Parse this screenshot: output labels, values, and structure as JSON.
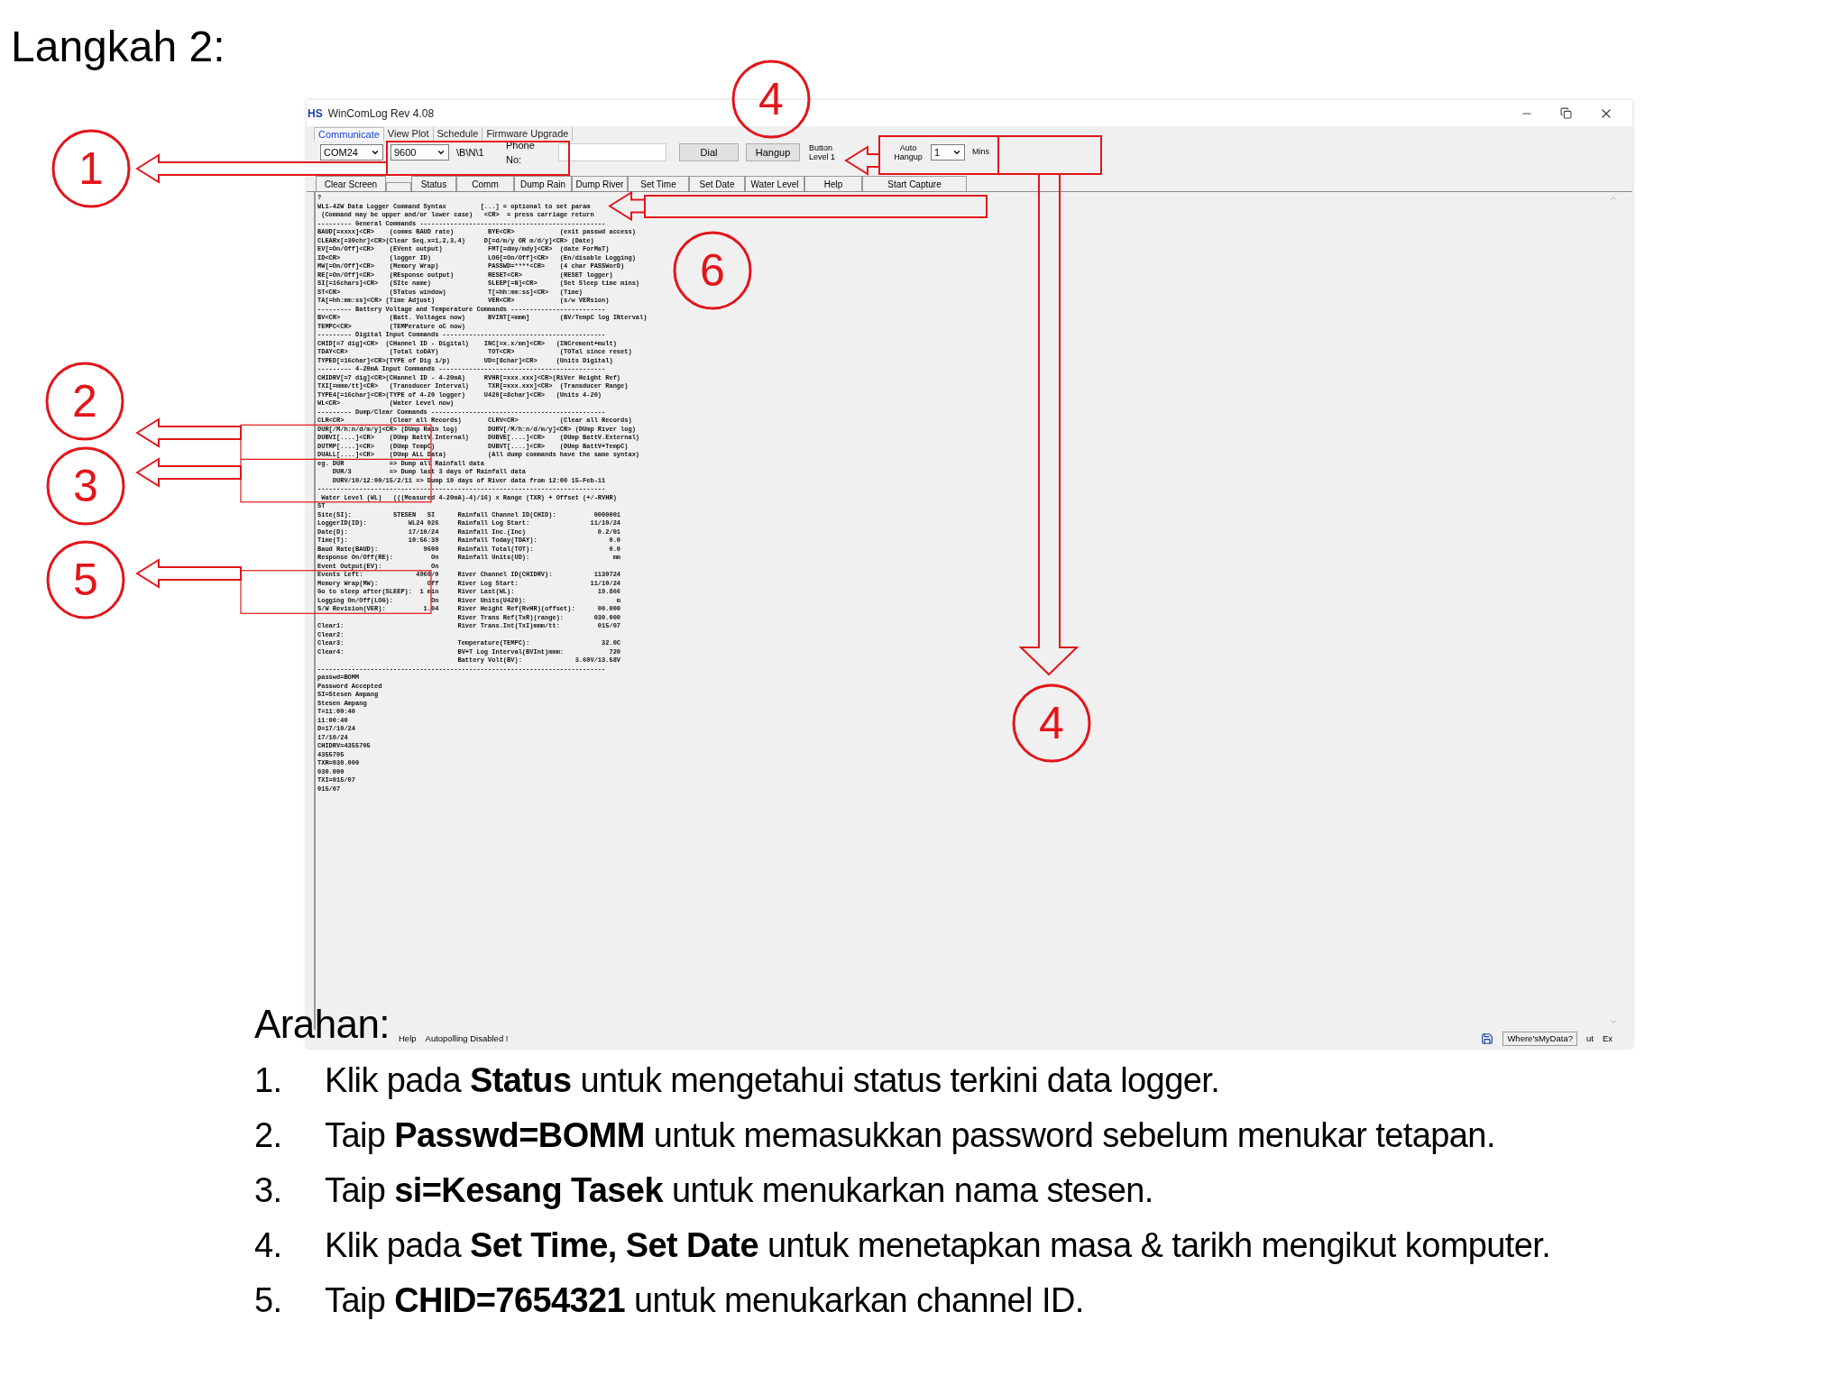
{
  "slide_title": "Langkah 2:",
  "window": {
    "logo": "HS",
    "title": "WinComLog Rev 4.08",
    "menu_tabs": [
      {
        "label": "Communicate",
        "selected": true
      },
      {
        "label": "View Plot",
        "selected": false
      },
      {
        "label": "Schedule",
        "selected": false
      },
      {
        "label": "Firmware Upgrade",
        "selected": false
      }
    ],
    "port": "COM24",
    "baud": "9600",
    "settings": "\\B\\N\\1",
    "phone_label": "Phone No:",
    "dial_button": "Dial",
    "hangup_button": "Hangup",
    "button_level": [
      "Button",
      "Level 1"
    ],
    "auto_hangup_label": [
      "Auto",
      "Hangup"
    ],
    "auto_hangup_value": "1",
    "mins_label": "Mins",
    "command_buttons": [
      "Clear Screen",
      "Status",
      "Comm",
      "Dump Rain",
      "Dump River",
      "Set Time",
      "Set Date",
      "Water Level",
      "Help",
      "Start Capture"
    ],
    "terminal_lines": [
      "?",
      "WL1-42W Data Logger Command Syntax         [...] = optional to set param",
      " (Command may be upper and/or lower case)   <CR>  = press carriage return",
      "--------- General Commands -------------------------------------------------",
      "BAUD[=xxxx]<CR>    (comms BAUD rate)         BYE<CR>            (exit passwd access)",
      "CLEARx[=30chr]<CR>(Clear Seq.x=1,2,3,4)     D[=d/m/y OR m/d/y]<CR> (Date)",
      "EV[=On/Off]<CR>    (EVent output)            FMT[=dmy/mdy]<CR>  (date ForMaT)",
      "ID<CR>             (logger ID)               LOG[=On/Off]<CR>   (En/disable Logging)",
      "MW[=On/Off]<CR>    (Memory Wrap)             PASSWD=****<CR>    (4 char PASSWorD)",
      "RE[=On/Off]<CR>    (REsponse output)         RESET<CR>          (RESET logger)",
      "SI[=16chars]<CR>   (SIte name)               SLEEP[=N]<CR>      (Set Sleep time mins)",
      "ST<CR>             (STatus window)           T[=hh:mm:ss]<CR>   (Time)",
      "TA[=hh:mm:ss]<CR> (Time Adjust)              VER<CR>            (s/w VERsion)",
      "--------- Battery Voltage and Temperature Commands -------------------------",
      "BV<CR>             (Batt. Voltages now)      BVINT[=mmm]        (BV/TempC log INterval)",
      "TEMPC<CR>          (TEMPerature oC now)",
      "--------- Digital Input Commands -------------------------------------------",
      "CHID[=7 dig]<CR>  (CHannel ID - Digital)    INC[=x.x/mn]<CR>   (INCrement+mult)",
      "TDAY<CR>           (Total toDAY)             TOT<CR>            (TOTal since reset)",
      "TYPED[=16char]<CR>(TYPE of Dig i/p)         UD=[8char]<CR>     (Units Digital)",
      "--------- 4-20mA Input Commands --------------------------------------------",
      "CHIDRV[=7 dig]<CR>(CHannel ID - 4-20mA)     RVHR[=xxx.xxx]<CR>(RiVer Height Ref)",
      "TXI[=mmm/tt]<CR>   (Transducer Interval)     TXR[=xxx.xxx]<CR>  (Transducer Range)",
      "TYPE4[=16char]<CR>(TYPE of 4-20 logger)     U420[=8char]<CR>   (Units 4-20)",
      "WL<CR>             (Water Level now)",
      "--------- Dump/Clear Commands ----------------------------------------------",
      "CLR<CR>            (Clear all Records)       CLRV<CR>           (Clear all Records)",
      "DUR[/M/h:n/d/m/y]<CR> (DUmp Rain log)        DURV[/M/h:n/d/m/y]<CR> (DUmp River log)",
      "DUBVI[....]<CR>    (DUmp BattV.Internal)     DUBVE[....]<CR>    (DUmp BattV.External)",
      "DUTMP[....]<CR>    (DUmp TempC)              DUBVT[....]<CR>    (DUmp BattV+TempC)",
      "DUALL[....]<CR>    (DUmp ALL Data)           (All dump commands have the same syntax)",
      "eg. DUR            => Dump all Rainfall data",
      "    DUR/3          => Dump last 3 days of Rainfall data",
      "    DURV/10/12:00/15/2/11 => Dump 10 days of River data from 12:00 15-Feb-11",
      "----------------------------------------------------------------------------",
      " Water Level (WL)   (((Measured 4-20mA)-4)/16) x Range (TXR) + Offset (+/-RVHR)",
      "ST",
      "Site(SI):           STESEN   SI      Rainfall Channel ID(CHID):          0000001",
      "LoggerID(ID):           WL24 026     Rainfall Log Start:                11/10/24",
      "Date(D):                17/10/24     Rainfall Inc.(Inc)                   0.2/01",
      "Time(T):                10:56:39     Rainfall Today(TDAY):                   0.0",
      "Baud Rate(BAUD):            9600     Rainfall Total(TOT):                    0.0",
      "Response On/Off(RE):          On     Rainfall Units(UD):                      mm",
      "Event Output(EV):             On",
      "Events Left:              4960/0     River Channel ID(CHIDRV):           1130724",
      "Memory Wrap(MW):             Off     River Log Start:                   11/10/24",
      "Go to sleep after(SLEEP):  1 min     River Last(WL):                      19.866",
      "Logging On/Off(LOG):          On     River Units(U420):                        m",
      "S/W Revision(VER):          1.04     River Height Ref(RvHR)(offset):      00.000",
      "                                     River Trans Ref(TxR)(range):        030.000",
      "Clear1:                              River Trans.Int(TxI)mmm/tt:          015/07",
      "Clear2:",
      "Clear3:                              Temperature(TEMPC):                   32.0C",
      "Clear4:                              BV+T Log Interval(BVInt)mmm:            720",
      "                                     Battery Volt(BV):              3.60V/13.58V",
      "----------------------------------------------------------------------------",
      "passwd=BOMM",
      "Password Accepted",
      "SI=Stesen Ampang",
      "Stesen Ampang",
      "T=11:00:40",
      "11:00:40",
      "D=17/10/24",
      "17/10/24",
      "CHIDRV=4355705",
      "4355705",
      "TXR=030.000",
      "030.000",
      "TXI=015/07",
      "015/07"
    ],
    "status_bar": {
      "left": [
        "Help",
        "Autopolling Disabled !"
      ],
      "right": [
        "Where'sMyData?",
        "ut",
        "Ex"
      ]
    }
  },
  "callouts": [
    "4",
    "1",
    "6",
    "2",
    "3",
    "5",
    "4"
  ],
  "instructions": {
    "heading": "Arahan:",
    "items": [
      {
        "number": "1.",
        "text": "Klik pada **Status** untuk mengetahui status terkini data logger."
      },
      {
        "number": "2.",
        "text": "Taip **Passwd=BOMM** untuk memasukkan password sebelum menukar tetapan."
      },
      {
        "number": "3.",
        "text": "Taip **si=Kesang Tasek** untuk menukarkan nama stesen."
      },
      {
        "number": "4.",
        "text": "Klik pada **Set Time, Set Date** untuk menetapkan masa & tarikh mengikut komputer."
      },
      {
        "number": "5.",
        "text": "Taip **CHID=7654321** untuk menukarkan channel ID."
      }
    ]
  }
}
